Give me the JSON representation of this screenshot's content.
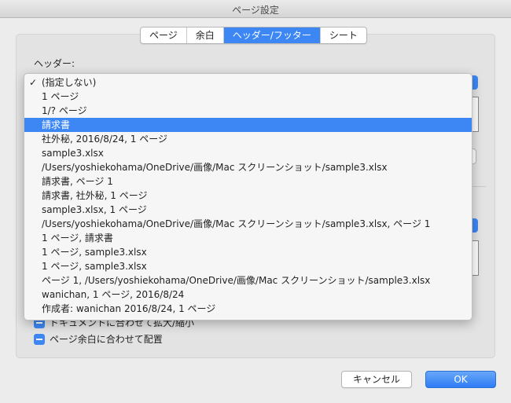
{
  "window": {
    "title": "ページ設定"
  },
  "tabs": [
    {
      "label": "ページ",
      "active": false
    },
    {
      "label": "余白",
      "active": false
    },
    {
      "label": "ヘッダー/フッター",
      "active": true
    },
    {
      "label": "シート",
      "active": false
    }
  ],
  "header_section": {
    "label": "ヘッダー:"
  },
  "dropdown": {
    "checked_index": 0,
    "highlighted_index": 3,
    "items": [
      "(指定しない)",
      "1 ページ",
      "1/? ページ",
      "請求書",
      "社外秘, 2016/8/24, 1 ページ",
      "sample3.xlsx",
      "/Users/yoshiekohama/OneDrive/画像/Mac スクリーンショット/sample3.xlsx",
      "請求書, ページ 1",
      "請求書, 社外秘, 1 ページ",
      "sample3.xlsx, 1 ページ",
      "/Users/yoshiekohama/OneDrive/画像/Mac スクリーンショット/sample3.xlsx, ページ 1",
      "1 ページ, 請求書",
      "1 ページ, sample3.xlsx",
      "1 ページ, sample3.xlsx",
      "ページ 1, /Users/yoshiekohama/OneDrive/画像/Mac スクリーンショット/sample3.xlsx",
      "wanichan, 1 ページ, 2016/8/24",
      "作成者: wanichan 2016/8/24, 1 ページ"
    ],
    "check_symbol": "✓"
  },
  "options": {
    "scale_with_document": "ドキュメントに合わせて拡大/縮小",
    "align_with_margins": "ページ余白に合わせて配置"
  },
  "buttons": {
    "cancel": "キャンセル",
    "ok": "OK"
  },
  "colors": {
    "accent": "#3d87f5"
  }
}
